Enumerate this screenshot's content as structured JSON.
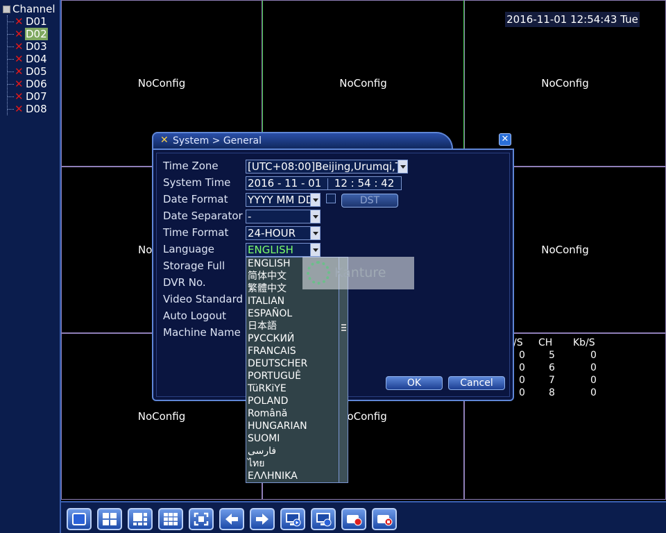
{
  "sidebar": {
    "header": "Channel",
    "channels": [
      "D01",
      "D02",
      "D03",
      "D04",
      "D05",
      "D06",
      "D07",
      "D08"
    ],
    "selected": "D02"
  },
  "grid": {
    "cell_label": "NoConfig",
    "datetime": "2016-11-01 12:54:43 Tue"
  },
  "stats": {
    "headers": [
      "/S",
      "CH",
      "Kb/S"
    ],
    "rows": [
      [
        "0",
        "5",
        "0"
      ],
      [
        "0",
        "6",
        "0"
      ],
      [
        "0",
        "7",
        "0"
      ],
      [
        "0",
        "8",
        "0"
      ]
    ]
  },
  "dialog": {
    "title": "System > General",
    "labels": {
      "time_zone": "Time Zone",
      "system_time": "System Time",
      "date_format": "Date Format",
      "date_separator": "Date Separator",
      "time_format": "Time Format",
      "language": "Language",
      "storage_full": "Storage Full",
      "dvr_no": "DVR No.",
      "video_standard": "Video Standard",
      "auto_logout": "Auto Logout",
      "machine_name": "Machine Name"
    },
    "values": {
      "time_zone": "[UTC+08:00]Beijing,Urumqi,Ta",
      "system_date": "2016 - 11 - 01",
      "system_clock": "12 : 54 : 42",
      "date_format": "YYYY MM DD",
      "date_separator": "-",
      "time_format": "24-HOUR",
      "language": "ENGLISH"
    },
    "dst_label": "DST",
    "ok_label": "OK",
    "cancel_label": "Cancel",
    "language_options": [
      "ENGLISH",
      "简体中文",
      "繁體中文",
      "ITALIAN",
      "ESPAÑOL",
      "日本語",
      "РУССКИЙ",
      "FRANCAIS",
      "DEUTSCHER",
      "PORTUGUÊ",
      "TüRKiYE",
      "POLAND",
      "Română",
      "HUNGARIAN",
      "SUOMI",
      "فارسی",
      "ไทย",
      "ΕΛΛΗΝΙΚΑ"
    ]
  },
  "watermark": {
    "text": "Kanture"
  },
  "toolbar": {
    "icons": [
      "single-view-icon",
      "quad-view-icon",
      "nine-view-icon",
      "sixteen-view-icon",
      "fullscreen-icon",
      "previous-icon",
      "next-icon",
      "playback-icon",
      "monitor-icon",
      "record-icon",
      "stop-record-icon"
    ]
  },
  "colors": {
    "background": "#000000",
    "panel": "#0b1d4d",
    "selected_channel": "#7fa860",
    "error_x": "#e01818",
    "language_value": "#7dff6b"
  }
}
